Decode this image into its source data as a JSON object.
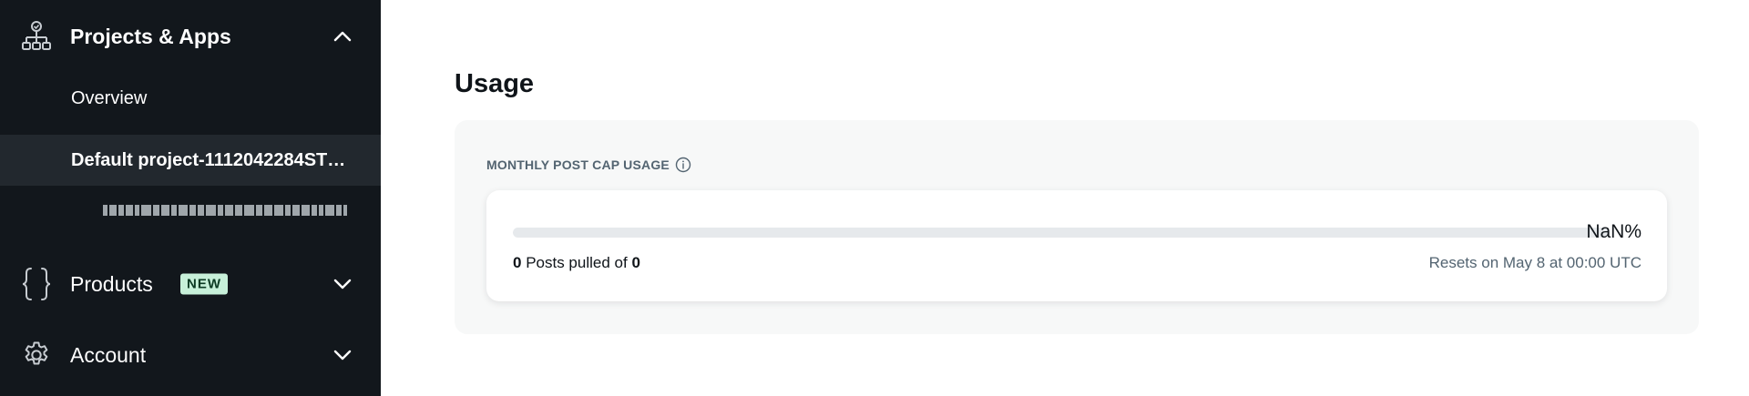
{
  "sidebar": {
    "projects": {
      "label": "Projects & Apps",
      "icon": "hierarchy-icon",
      "expanded": true
    },
    "overview": {
      "label": "Overview"
    },
    "project": {
      "label": "Default project-1112042284ST…"
    },
    "app": {
      "label": "1120422844577958012…"
    },
    "products": {
      "label": "Products",
      "badge": "NEW",
      "icon": "braces-icon"
    },
    "account": {
      "label": "Account",
      "icon": "gear-icon"
    }
  },
  "main": {
    "title": "Usage",
    "cap_label": "MONTHLY POST CAP USAGE",
    "percent_text": "NaN%",
    "progress_fraction": 0,
    "pulled_count": "0",
    "pulled_text": " Posts pulled of ",
    "pulled_total": "0",
    "resets_text": "Resets on May 8 at 00:00 UTC"
  },
  "colors": {
    "sidebar_bg": "#12171c",
    "active_item_bg": "#22282e",
    "badge_bg": "#c7f0d9",
    "track": "#e6e9ec",
    "panel_bg": "#f7f8f8"
  }
}
